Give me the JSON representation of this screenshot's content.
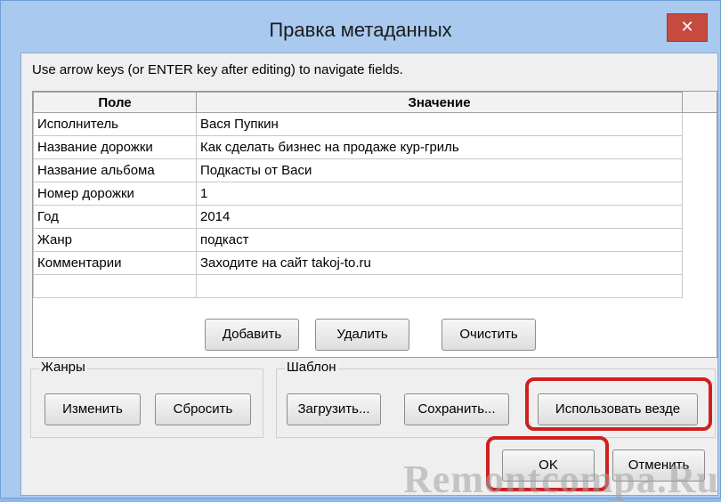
{
  "window": {
    "title": "Правка метаданных",
    "close_symbol": "✕"
  },
  "hint": "Use arrow keys (or ENTER key after editing) to navigate fields.",
  "table": {
    "headers": [
      "Поле",
      "Значение"
    ],
    "rows": [
      [
        "Исполнитель",
        "Вася Пупкин"
      ],
      [
        "Название дорожки",
        "Как сделать бизнес на продаже кур-гриль"
      ],
      [
        "Название альбома",
        "Подкасты от Васи"
      ],
      [
        "Номер дорожки",
        "1"
      ],
      [
        "Год",
        "2014"
      ],
      [
        "Жанр",
        "подкаст"
      ],
      [
        "Комментарии",
        "Заходите на сайт takoj-to.ru"
      ],
      [
        "",
        ""
      ]
    ]
  },
  "buttons": {
    "add": "Добавить",
    "delete": "Удалить",
    "clear": "Очистить",
    "edit": "Изменить",
    "reset": "Сбросить",
    "load": "Загрузить...",
    "save": "Сохранить...",
    "use_everywhere": "Использовать везде",
    "ok": "OK",
    "cancel": "Отменить"
  },
  "groups": {
    "genres": "Жанры",
    "template": "Шаблон"
  },
  "watermark": "Remontcompa.Ru",
  "colors": {
    "highlight": "#d01f1f",
    "close_button": "#c74a3f"
  }
}
